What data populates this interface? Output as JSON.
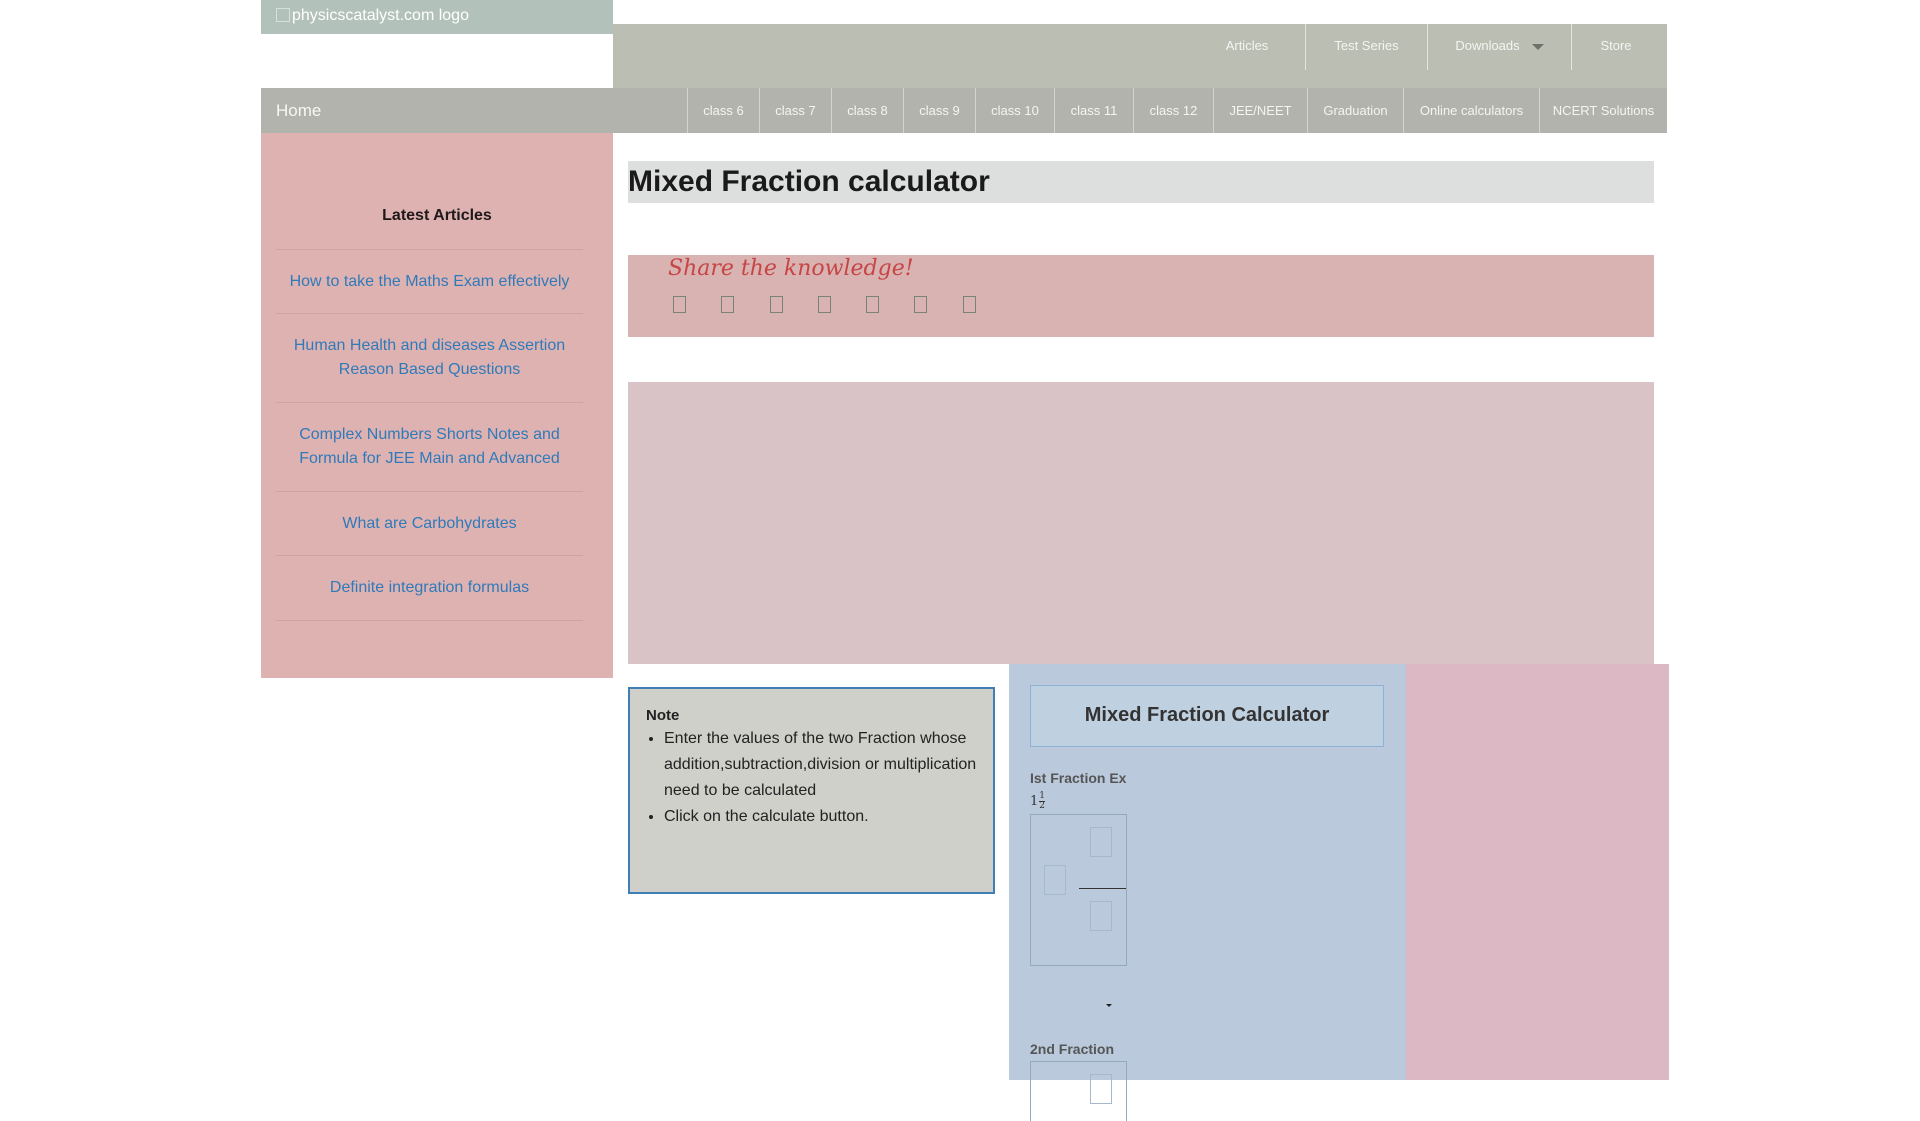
{
  "header": {
    "logo_alt": "physicscatalyst.com logo",
    "top_nav": [
      {
        "label": "Articles"
      },
      {
        "label": "Test Series"
      },
      {
        "label": "Downloads",
        "has_dropdown": true
      },
      {
        "label": "Store"
      }
    ]
  },
  "main_nav": {
    "home": "Home",
    "items": [
      "class 6",
      "class 7",
      "class 8",
      "class 9",
      "class 10",
      "class 11",
      "class 12",
      "JEE/NEET",
      "Graduation",
      "Online calculators",
      "NCERT Solutions"
    ]
  },
  "sidebar": {
    "title": "Latest Articles",
    "articles": [
      "How to take the Maths Exam effectively",
      "Human Health and diseases Assertion Reason Based Questions",
      "Complex Numbers Shorts Notes and Formula for JEE Main and Advanced",
      "What are Carbohydrates",
      "Definite integration formulas"
    ]
  },
  "main": {
    "page_title": "Mixed Fraction calculator",
    "share_title": "Share the knowledge!",
    "share_icons": [
      "facebook-icon",
      "twitter-icon",
      "linkedin-icon",
      "pinterest-icon",
      "whatsapp-icon",
      "email-icon",
      "print-icon"
    ]
  },
  "note": {
    "title": "Note",
    "items": [
      "Enter the values of the two Fraction whose addition,subtraction,division or multiplication need to be calculated",
      "Click on the calculate button."
    ]
  },
  "calculator": {
    "title": "Mixed Fraction Calculator",
    "first_label": "Ist Fraction Ex",
    "example_whole": "1",
    "example_num": "1",
    "example_den": "2",
    "second_label": "2nd Fraction",
    "operation_selected": ""
  },
  "colors": {
    "link": "#2f7ab9",
    "share_title": "#c74545",
    "note_border": "#3f7fb6"
  }
}
